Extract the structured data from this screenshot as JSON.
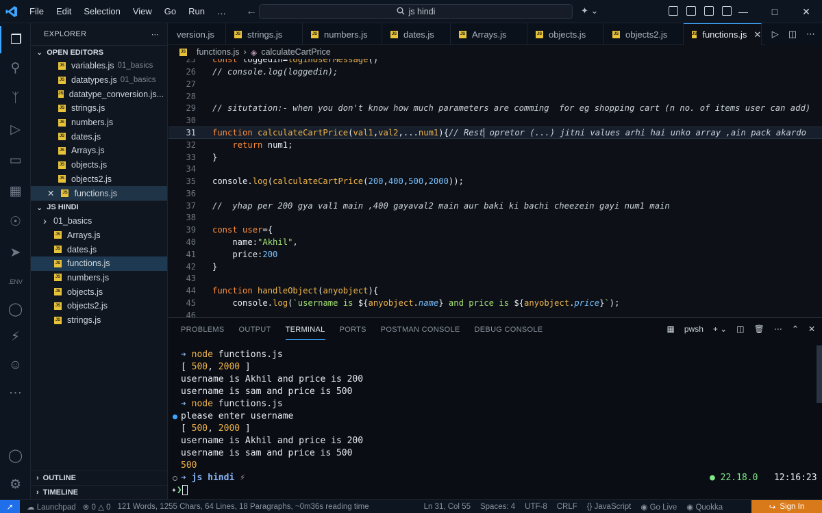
{
  "menu": [
    "File",
    "Edit",
    "Selection",
    "View",
    "Go",
    "Run",
    "…"
  ],
  "search": {
    "text": "js hindi"
  },
  "sidebar": {
    "title": "EXPLORER",
    "open_editors_label": "OPEN EDITORS",
    "open_editors": [
      {
        "name": "variables.js",
        "desc": "01_basics"
      },
      {
        "name": "datatypes.js",
        "desc": "01_basics"
      },
      {
        "name": "datatype_conversion.js...",
        "desc": ""
      },
      {
        "name": "strings.js",
        "desc": ""
      },
      {
        "name": "numbers.js",
        "desc": ""
      },
      {
        "name": "dates.js",
        "desc": ""
      },
      {
        "name": "Arrays.js",
        "desc": ""
      },
      {
        "name": "objects.js",
        "desc": ""
      },
      {
        "name": "objects2.js",
        "desc": ""
      },
      {
        "name": "functions.js",
        "desc": ""
      }
    ],
    "folder_label": "JS HINDI",
    "folder_items": [
      {
        "name": "01_basics",
        "type": "folder"
      },
      {
        "name": "Arrays.js",
        "type": "file"
      },
      {
        "name": "dates.js",
        "type": "file"
      },
      {
        "name": "functions.js",
        "type": "file"
      },
      {
        "name": "numbers.js",
        "type": "file"
      },
      {
        "name": "objects.js",
        "type": "file"
      },
      {
        "name": "objects2.js",
        "type": "file"
      },
      {
        "name": "strings.js",
        "type": "file"
      }
    ],
    "outline_label": "OUTLINE",
    "timeline_label": "TIMELINE"
  },
  "tabs": [
    "version.js",
    "strings.js",
    "numbers.js",
    "dates.js",
    "Arrays.js",
    "objects.js",
    "objects2.js",
    "functions.js"
  ],
  "breadcrumb": {
    "file": "functions.js",
    "symbol": "calculateCartPrice"
  },
  "editor": {
    "line_numbers": [
      "25",
      "26",
      "27",
      "28",
      "29",
      "30",
      "31",
      "32",
      "33",
      "34",
      "35",
      "36",
      "37",
      "38",
      "39",
      "40",
      "41",
      "42",
      "43",
      "44",
      "45",
      "46"
    ],
    "current_line": "31"
  },
  "panel": {
    "tabs": [
      "PROBLEMS",
      "OUTPUT",
      "TERMINAL",
      "PORTS",
      "POSTMAN CONSOLE",
      "DEBUG CONSOLE"
    ],
    "shell": "pwsh",
    "terminal": {
      "cmd1": "node",
      "file1": " functions.js",
      "out1": "username is Akhil and price is 200",
      "out2": "username is sam and price is 500",
      "cmd2": "node",
      "file2": " functions.js",
      "out3": "please enter username",
      "out4": "username is Akhil and price is 200",
      "out5": "username is sam and price is 500",
      "out6": "500",
      "prompt_dir": "js hindi",
      "node_version": "22.18.0",
      "time": "12:16:23"
    }
  },
  "status": {
    "launchpad": "Launchpad",
    "errors": "0",
    "warnings": "0",
    "stats": "121 Words, 1255 Chars, 64 Lines, 18 Paragraphs, ~0m36s reading time",
    "position": "Ln 31, Col 55",
    "spaces": "Spaces: 4",
    "encoding": "UTF-8",
    "eol": "CRLF",
    "language": "JavaScript",
    "golive": "Go Live",
    "quokka": "Quokka",
    "signin": "Sign In"
  },
  "colors": {
    "accent": "#3ea6ff",
    "keyword": "#ff8c3a",
    "function": "#f0b44c",
    "string": "#a5e075",
    "number": "#79c0ff",
    "signin": "#d97a1a"
  }
}
